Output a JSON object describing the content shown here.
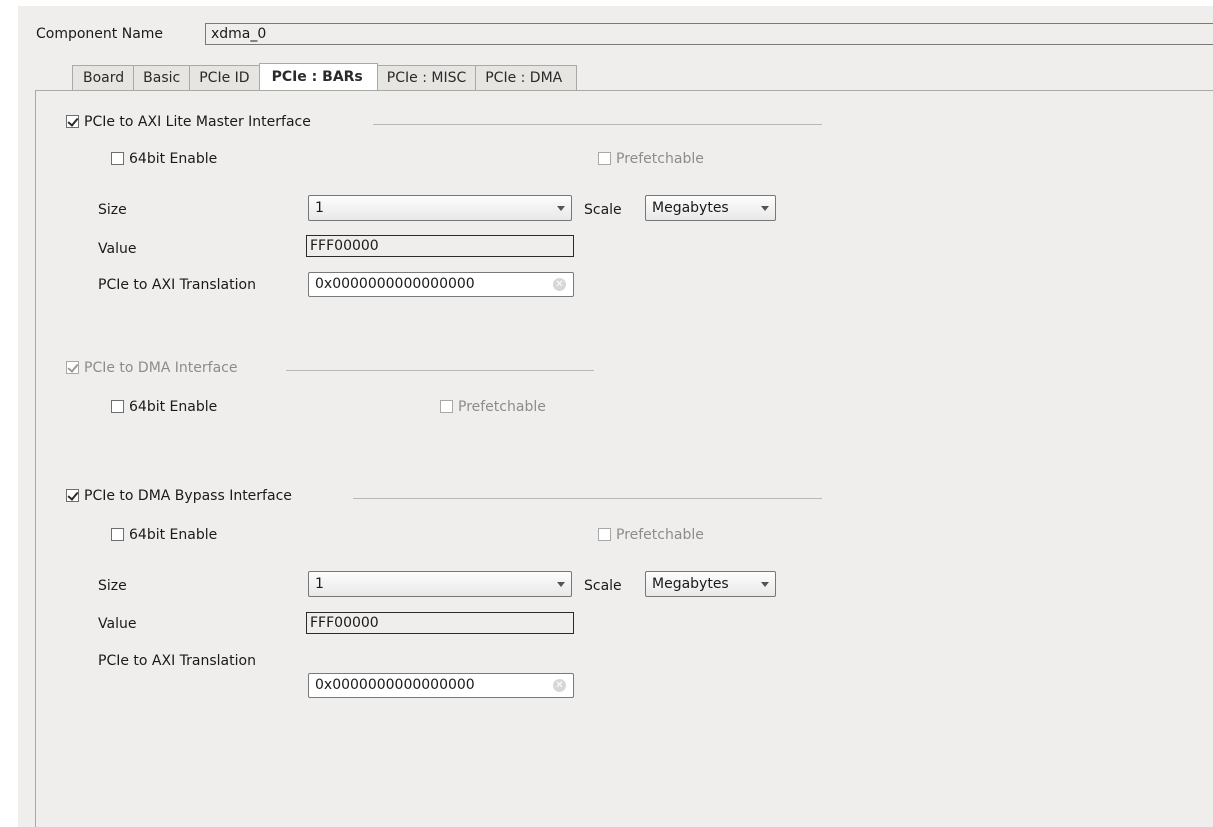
{
  "component": {
    "label": "Component Name",
    "value": "xdma_0"
  },
  "tabs": [
    {
      "label": "Board"
    },
    {
      "label": "Basic"
    },
    {
      "label": "PCIe ID"
    },
    {
      "label": "PCIe : BARs"
    },
    {
      "label": "PCIe : MISC"
    },
    {
      "label": "PCIe : DMA"
    }
  ],
  "axi_lite": {
    "title": "PCIe to AXI Lite Master Interface",
    "checked": true,
    "enable64_label": "64bit Enable",
    "prefetch_label": "Prefetchable",
    "size_label": "Size",
    "size_value": "1",
    "scale_label": "Scale",
    "scale_value": "Megabytes",
    "value_label": "Value",
    "value": "FFF00000",
    "translation_label": "PCIe to AXI Translation",
    "translation_value": "0x0000000000000000"
  },
  "dma": {
    "title": "PCIe to DMA Interface",
    "checked": true,
    "enable64_label": "64bit Enable",
    "prefetch_label": "Prefetchable"
  },
  "bypass": {
    "title": "PCIe to DMA Bypass Interface",
    "checked": true,
    "enable64_label": "64bit Enable",
    "prefetch_label": "Prefetchable",
    "size_label": "Size",
    "size_value": "1",
    "scale_label": "Scale",
    "scale_value": "Megabytes",
    "value_label": "Value",
    "value": "FFF00000",
    "translation_label": "PCIe to AXI Translation",
    "translation_value": "0x0000000000000000"
  }
}
